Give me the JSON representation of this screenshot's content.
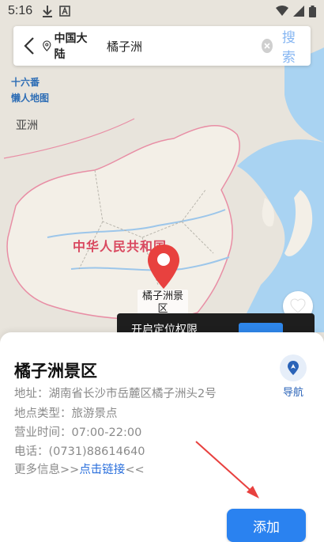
{
  "status_bar": {
    "time": "5:16"
  },
  "map": {
    "logo_line1": "十六番",
    "logo_line2": "懒人地图",
    "continent": "亚洲",
    "country": "中华人民共和国",
    "pin_label": "橘子洲景区"
  },
  "toast": {
    "text": "开启定位权限"
  },
  "search": {
    "region": "中国大陆",
    "query": "橘子洲",
    "search_label": "搜索"
  },
  "place": {
    "title": "橘子洲景区",
    "navigate_label": "导航",
    "address": "地址：湖南省长沙市岳麓区橘子洲头2号",
    "type": "地点类型：旅游景点",
    "hours": "营业时间：07:00-22:00",
    "phone": "电话：(0731)88614640",
    "more_prefix": "更多信息>>",
    "more_link": "点击链接",
    "more_suffix": "<<",
    "add_label": "添加"
  },
  "colors": {
    "accent": "#2a82f0",
    "link": "#2a6fdc",
    "border_red": "#d9485f",
    "pin": "#e8413f"
  },
  "icons": [
    "download-icon",
    "app-icon",
    "wifi-icon",
    "signal-icon",
    "battery-icon",
    "back-arrow-icon",
    "location-pin-icon",
    "clear-icon",
    "navigate-icon",
    "map-pin-icon",
    "heart-icon",
    "red-arrow-icon"
  ]
}
